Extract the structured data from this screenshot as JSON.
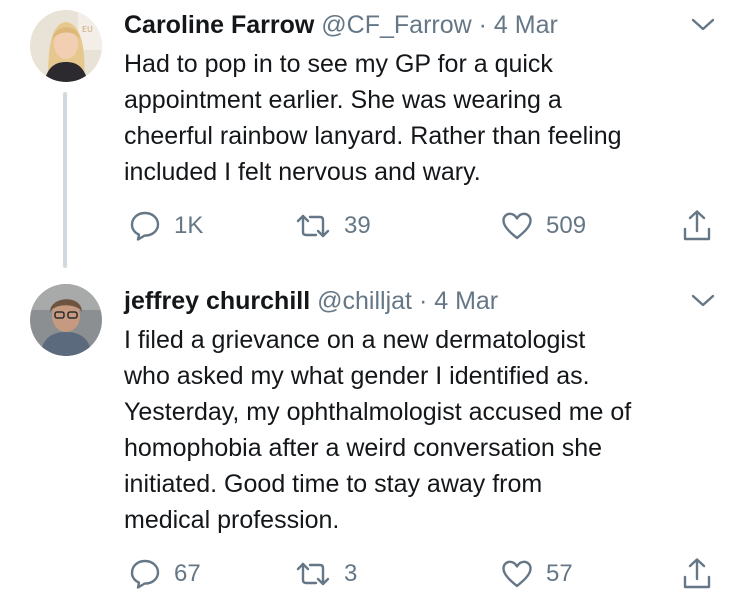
{
  "tweets": [
    {
      "name": "Caroline Farrow",
      "handle": "@CF_Farrow",
      "separator": "·",
      "date": "4 Mar",
      "lines": [
        "Had to pop in to see my GP for a quick",
        "appointment earlier. She was wearing a",
        "cheerful rainbow lanyard. Rather than feeling",
        "included I felt nervous and wary."
      ],
      "replies": "1K",
      "retweets": "39",
      "likes": "509"
    },
    {
      "name": "jeffrey churchill",
      "handle": "@chilljat",
      "separator": "·",
      "date": "4 Mar",
      "lines": [
        "I filed a grievance on a new dermatologist",
        "who asked my what gender I identified as.",
        "Yesterday, my ophthalmologist accused me of",
        "homophobia after a weird conversation she",
        "initiated.  Good time to stay away from",
        "medical profession."
      ],
      "replies": "67",
      "retweets": "3",
      "likes": "57"
    }
  ],
  "icons": {
    "reply": "reply-icon",
    "retweet": "retweet-icon",
    "like": "heart-icon",
    "share": "share-icon",
    "caret": "chevron-down-icon"
  },
  "colors": {
    "text": "#14171a",
    "muted": "#657786",
    "thread_line": "#cfd9de"
  }
}
